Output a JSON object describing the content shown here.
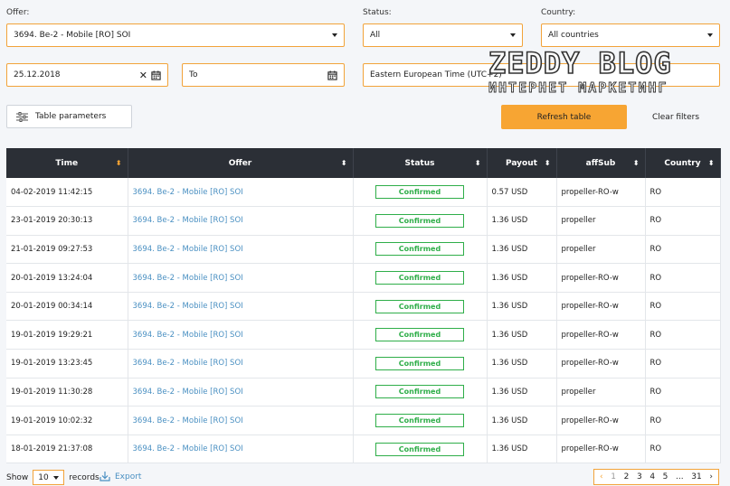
{
  "filters": {
    "offer_label": "Offer:",
    "offer_value": "3694. Be-2 - Mobile [RO] SOI",
    "status_label": "Status:",
    "status_value": "All",
    "country_label": "Country:",
    "country_value": "All countries",
    "date_from": "25.12.2018",
    "date_to_placeholder": "To",
    "timezone": "Eastern European Time (UTC+2)"
  },
  "buttons": {
    "table_params": "Table parameters",
    "refresh": "Refresh table",
    "clear": "Clear filters"
  },
  "watermark": {
    "line1": "ZEDDY BLOG",
    "line2": "ИНТЕРНЕТ МАРКЕТИНГ"
  },
  "table": {
    "headers": [
      "Time",
      "Offer",
      "Status",
      "Payout",
      "affSub",
      "Country"
    ],
    "rows": [
      {
        "time": "04-02-2019 11:42:15",
        "offer": "3694. Be-2 - Mobile [RO] SOI",
        "status": "Confirmed",
        "payout": "0.57 USD",
        "affsub": "propeller-RO-w",
        "country": "RO"
      },
      {
        "time": "23-01-2019 20:30:13",
        "offer": "3694. Be-2 - Mobile [RO] SOI",
        "status": "Confirmed",
        "payout": "1.36 USD",
        "affsub": "propeller",
        "country": "RO"
      },
      {
        "time": "21-01-2019 09:27:53",
        "offer": "3694. Be-2 - Mobile [RO] SOI",
        "status": "Confirmed",
        "payout": "1.36 USD",
        "affsub": "propeller",
        "country": "RO"
      },
      {
        "time": "20-01-2019 13:24:04",
        "offer": "3694. Be-2 - Mobile [RO] SOI",
        "status": "Confirmed",
        "payout": "1.36 USD",
        "affsub": "propeller-RO-w",
        "country": "RO"
      },
      {
        "time": "20-01-2019 00:34:14",
        "offer": "3694. Be-2 - Mobile [RO] SOI",
        "status": "Confirmed",
        "payout": "1.36 USD",
        "affsub": "propeller-RO-w",
        "country": "RO"
      },
      {
        "time": "19-01-2019 19:29:21",
        "offer": "3694. Be-2 - Mobile [RO] SOI",
        "status": "Confirmed",
        "payout": "1.36 USD",
        "affsub": "propeller-RO-w",
        "country": "RO"
      },
      {
        "time": "19-01-2019 13:23:45",
        "offer": "3694. Be-2 - Mobile [RO] SOI",
        "status": "Confirmed",
        "payout": "1.36 USD",
        "affsub": "propeller-RO-w",
        "country": "RO"
      },
      {
        "time": "19-01-2019 11:30:28",
        "offer": "3694. Be-2 - Mobile [RO] SOI",
        "status": "Confirmed",
        "payout": "1.36 USD",
        "affsub": "propeller",
        "country": "RO"
      },
      {
        "time": "19-01-2019 10:02:32",
        "offer": "3694. Be-2 - Mobile [RO] SOI",
        "status": "Confirmed",
        "payout": "1.36 USD",
        "affsub": "propeller-RO-w",
        "country": "RO"
      },
      {
        "time": "18-01-2019 21:37:08",
        "offer": "3694. Be-2 - Mobile [RO] SOI",
        "status": "Confirmed",
        "payout": "1.36 USD",
        "affsub": "propeller-RO-w",
        "country": "RO"
      }
    ]
  },
  "footer": {
    "show_label": "Show",
    "page_size": "10",
    "records_label": "records",
    "export_label": "Export",
    "pages": [
      "1",
      "2",
      "3",
      "4",
      "5",
      "...",
      "31"
    ],
    "current_page": "1"
  },
  "colors": {
    "accent": "#f7a533",
    "header_bg": "#2b2f36",
    "link": "#4a90c2",
    "confirmed": "#2fae49"
  }
}
